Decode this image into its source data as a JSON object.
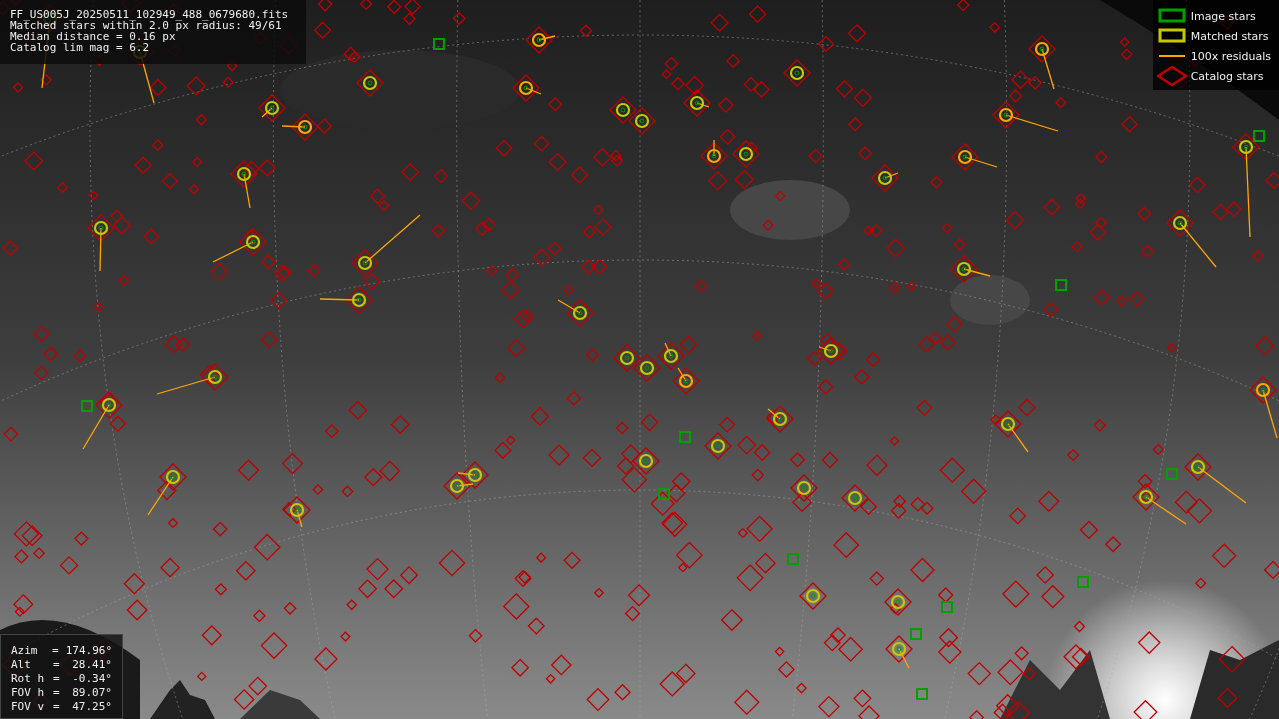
{
  "info_box": {
    "lines": [
      "FF_US005J_20250511_102949_488_0679680.fits",
      "Matched stars within 2.0 px radius: 49/61",
      "Median distance = 0.16 px",
      "Catalog lim mag = 6.2"
    ]
  },
  "legend": [
    {
      "label": "Image stars",
      "color": "#00a000"
    },
    {
      "kind": "matched",
      "label": "Matched stars",
      "color": "#c8c800"
    },
    {
      "kind": "residual",
      "label": "100x residuals",
      "color": "#ffa500"
    },
    {
      "kind": "catalog",
      "label": "Catalog stars",
      "color": "#c00000"
    }
  ],
  "pointing": [
    {
      "label": "Azim",
      "sep": "=",
      "value": "174.96°"
    },
    {
      "label": "Alt",
      "sep": "=",
      "value": "28.41°"
    },
    {
      "label": "Rot h",
      "sep": "=",
      "value": "-0.34°"
    },
    {
      "label": "FOV h",
      "sep": "=",
      "value": "89.07°"
    },
    {
      "label": "FOV v",
      "sep": "=",
      "value": "47.25°"
    }
  ]
}
